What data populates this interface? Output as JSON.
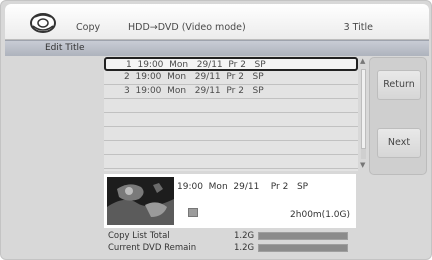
{
  "header": {
    "mode_label": "Copy",
    "route": "HDD→DVD (Video mode)",
    "title_count": "3 Title"
  },
  "subheader": {
    "title": "Edit Title"
  },
  "titles": [
    {
      "index": "1",
      "time": "19:00",
      "day": "Mon",
      "date": "29/11",
      "program": "Pr 2",
      "quality": "SP",
      "selected": true
    },
    {
      "index": "2",
      "time": "19:00",
      "day": "Mon",
      "date": "29/11",
      "program": "Pr 2",
      "quality": "SP",
      "selected": false
    },
    {
      "index": "3",
      "time": "19:00",
      "day": "Mon",
      "date": "29/11",
      "program": "Pr 2",
      "quality": "SP",
      "selected": false
    }
  ],
  "buttons": {
    "return_label": "Return",
    "next_label": "Next"
  },
  "detail": {
    "time": "19:00",
    "day": "Mon",
    "date": "29/11",
    "program": "Pr 2",
    "quality": "SP",
    "duration": "2h00m(1.0G)"
  },
  "totals": {
    "copy_list_label": "Copy List Total",
    "copy_list_size": "1.2G",
    "copy_list_fill": 1.0,
    "dvd_remain_label": "Current DVD Remain",
    "dvd_remain_size": "1.2G",
    "dvd_remain_fill": 1.0
  },
  "icons": {
    "logo": "dvd-disc-logo-icon",
    "scroll_up": "scroll-up-icon",
    "scroll_down": "scroll-down-icon",
    "title_type": "title-type-icon"
  }
}
